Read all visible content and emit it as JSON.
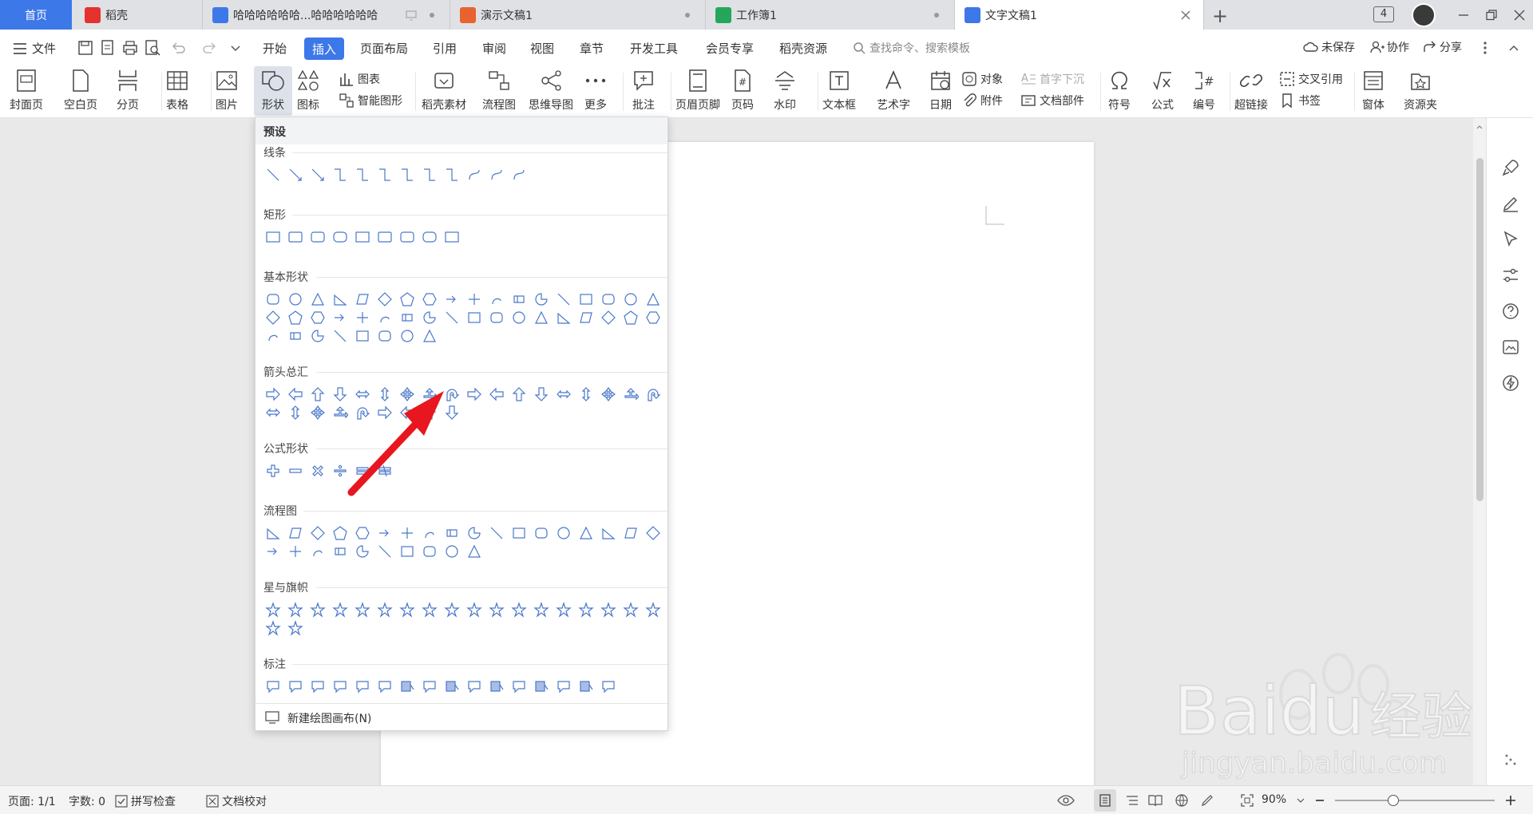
{
  "tabs": {
    "home": "首页",
    "items": [
      {
        "label": "稻壳",
        "color": "#e5322d"
      },
      {
        "label": "哈哈哈哈哈哈...哈哈哈哈哈哈",
        "color": "#3d78e9"
      },
      {
        "label": "演示文稿1",
        "color": "#e8632f"
      },
      {
        "label": "工作簿1",
        "color": "#26a65b"
      },
      {
        "label": "文字文稿1",
        "color": "#3d78e9"
      }
    ],
    "new_tab": "+",
    "window_count": "4"
  },
  "menu": {
    "file": "文件",
    "items": [
      "开始",
      "插入",
      "页面布局",
      "引用",
      "审阅",
      "视图",
      "章节",
      "开发工具",
      "会员专享",
      "稻壳资源"
    ],
    "search": "查找命令、搜索模板",
    "unsaved": "未保存",
    "collab": "协作",
    "share": "分享"
  },
  "ribbon": {
    "cover": "封面页",
    "blank": "空白页",
    "pagebreak": "分页",
    "table": "表格",
    "picture": "图片",
    "shape": "形状",
    "icon": "图标",
    "chart": "图表",
    "smart": "智能图形",
    "material": "稻壳素材",
    "flowchart": "流程图",
    "mindmap": "思维导图",
    "more": "更多",
    "comment": "批注",
    "header": "页眉页脚",
    "pagenum": "页码",
    "watermark": "水印",
    "textbox": "文本框",
    "wordart": "艺术字",
    "date": "日期",
    "object": "对象",
    "attach": "附件",
    "dropcap": "首字下沉",
    "docpart": "文档部件",
    "symbol": "符号",
    "formula": "公式",
    "numbering": "编号",
    "hyperlink": "超链接",
    "crossref": "交叉引用",
    "bookmark": "书签",
    "window": "窗体",
    "resource": "资源夹"
  },
  "dropdown": {
    "preset": "预设",
    "sections": [
      {
        "label": "线条",
        "rows": [
          12
        ]
      },
      {
        "label": "矩形",
        "rows": [
          9
        ]
      },
      {
        "label": "基本形状",
        "rows": [
          18,
          18,
          8
        ]
      },
      {
        "label": "箭头总汇",
        "rows": [
          18,
          9
        ]
      },
      {
        "label": "公式形状",
        "rows": [
          6
        ]
      },
      {
        "label": "流程图",
        "rows": [
          18,
          10
        ]
      },
      {
        "label": "星与旗帜",
        "rows": [
          18,
          2
        ]
      },
      {
        "label": "标注",
        "rows": [
          16
        ]
      }
    ],
    "footer": "新建绘图画布(N)"
  },
  "status": {
    "page": "页面: 1/1",
    "words": "字数: 0",
    "spell": "拼写检查",
    "proof": "文档校对",
    "zoom": "90%"
  },
  "watermark": {
    "brand": "Baidu",
    "brand2": "经验",
    "site": "jingyan.baidu.com"
  },
  "accent": "#3d78e9",
  "arrow_color": "#e8161e"
}
